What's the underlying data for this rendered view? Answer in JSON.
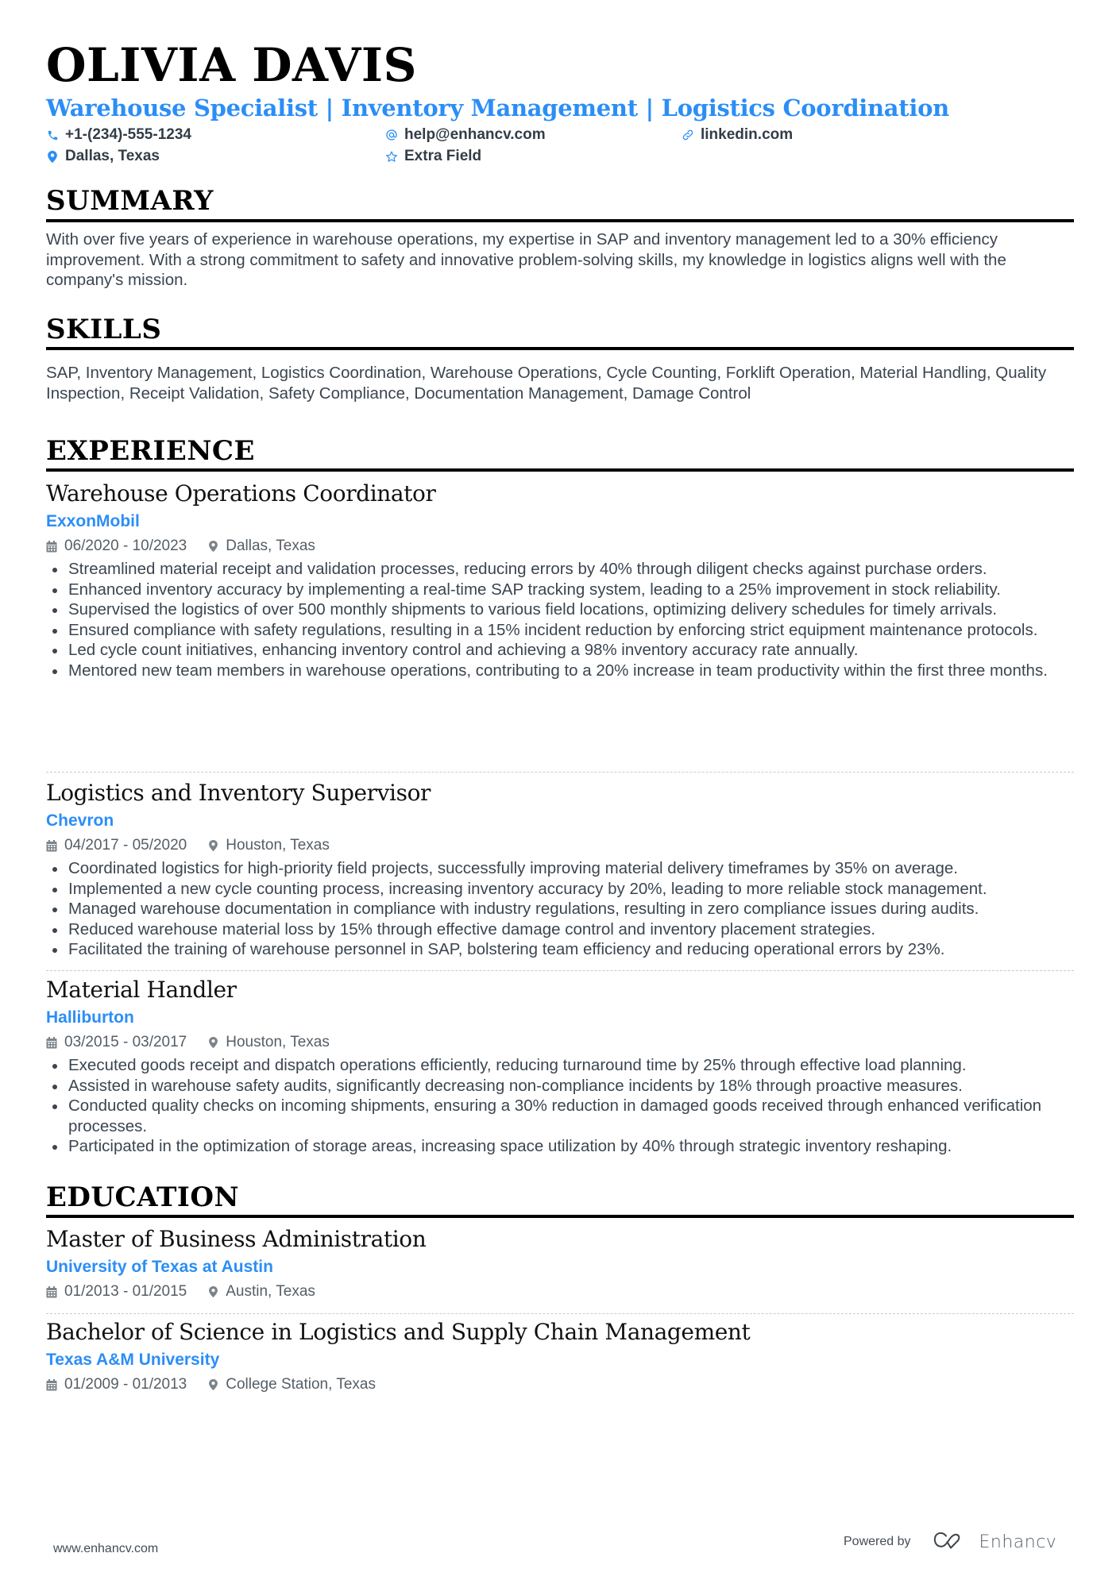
{
  "header": {
    "name": "OLIVIA DAVIS",
    "headline": "Warehouse Specialist | Inventory Management | Logistics Coordination",
    "contacts": {
      "phone": "+1-(234)-555-1234",
      "email": "help@enhancv.com",
      "linkedin": "linkedin.com",
      "location": "Dallas, Texas",
      "extra": "Extra Field"
    }
  },
  "summary": {
    "title": "SUMMARY",
    "text": "With over five years of experience in warehouse operations, my expertise in SAP and inventory management led to a 30% efficiency improvement. With a strong commitment to safety and innovative problem-solving skills, my knowledge in logistics aligns well with the company's mission."
  },
  "skills": {
    "title": "SKILLS",
    "text": "SAP, Inventory Management, Logistics Coordination, Warehouse Operations, Cycle Counting, Forklift Operation, Material Handling, Quality Inspection, Receipt Validation, Safety Compliance, Documentation Management, Damage Control"
  },
  "experience": {
    "title": "EXPERIENCE",
    "jobs": [
      {
        "title": "Warehouse Operations Coordinator",
        "company": "ExxonMobil",
        "dates": "06/2020 - 10/2023",
        "location": "Dallas, Texas",
        "bullets": [
          "Streamlined material receipt and validation processes, reducing errors by 40% through diligent checks against purchase orders.",
          "Enhanced inventory accuracy by implementing a real-time SAP tracking system, leading to a 25% improvement in stock reliability.",
          "Supervised the logistics of over 500 monthly shipments to various field locations, optimizing delivery schedules for timely arrivals.",
          "Ensured compliance with safety regulations, resulting in a 15% incident reduction by enforcing strict equipment maintenance protocols.",
          "Led cycle count initiatives, enhancing inventory control and achieving a 98% inventory accuracy rate annually.",
          "Mentored new team members in warehouse operations, contributing to a 20% increase in team productivity within the first three months."
        ]
      },
      {
        "title": "Logistics and Inventory Supervisor",
        "company": "Chevron",
        "dates": "04/2017 - 05/2020",
        "location": "Houston, Texas",
        "bullets": [
          "Coordinated logistics for high-priority field projects, successfully improving material delivery timeframes by 35% on average.",
          "Implemented a new cycle counting process, increasing inventory accuracy by 20%, leading to more reliable stock management.",
          "Managed warehouse documentation in compliance with industry regulations, resulting in zero compliance issues during audits.",
          "Reduced warehouse material loss by 15% through effective damage control and inventory placement strategies.",
          "Facilitated the training of warehouse personnel in SAP, bolstering team efficiency and reducing operational errors by 23%."
        ]
      },
      {
        "title": "Material Handler",
        "company": "Halliburton",
        "dates": "03/2015 - 03/2017",
        "location": "Houston, Texas",
        "bullets": [
          "Executed goods receipt and dispatch operations efficiently, reducing turnaround time by 25% through effective load planning.",
          "Assisted in warehouse safety audits, significantly decreasing non-compliance incidents by 18% through proactive measures.",
          "Conducted quality checks on incoming shipments, ensuring a 30% reduction in damaged goods received through enhanced verification processes.",
          "Participated in the optimization of storage areas, increasing space utilization by 40% through strategic inventory reshaping."
        ]
      }
    ]
  },
  "education": {
    "title": "EDUCATION",
    "items": [
      {
        "degree": "Master of Business Administration",
        "school": "University of Texas at Austin",
        "dates": "01/2013 - 01/2015",
        "location": "Austin, Texas"
      },
      {
        "degree": "Bachelor of Science in Logistics and Supply Chain Management",
        "school": "Texas A&M University",
        "dates": "01/2009 - 01/2013",
        "location": "College Station, Texas"
      }
    ]
  },
  "footer": {
    "website": "www.enhancv.com",
    "powered_by": "Powered by",
    "brand": "Enhancv"
  },
  "colors": {
    "accent": "#2b8ef6",
    "text": "#3b4550",
    "heading": "#000000"
  },
  "icons": {
    "phone": "phone-icon",
    "email": "at-icon",
    "linkedin": "link-icon",
    "location": "map-pin-icon",
    "extra": "star-icon",
    "date": "calendar-icon"
  }
}
